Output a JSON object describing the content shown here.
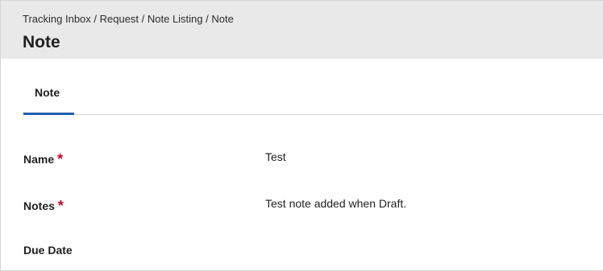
{
  "header": {
    "breadcrumb": "Tracking Inbox / Request / Note Listing / Note",
    "title": "Note"
  },
  "tabs": [
    {
      "label": "Note",
      "active": true
    }
  ],
  "fields": {
    "name": {
      "label": "Name",
      "required_mark": "*",
      "value": "Test"
    },
    "notes": {
      "label": "Notes",
      "required_mark": "*",
      "value": "Test note added when Draft."
    },
    "due_date": {
      "label": "Due Date",
      "value": ""
    }
  },
  "colors": {
    "header_bg": "#e9e9e9",
    "accent": "#1f5fae",
    "required": "#d0021b"
  }
}
